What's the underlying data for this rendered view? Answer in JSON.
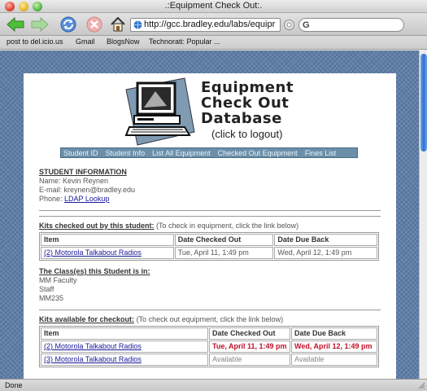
{
  "window": {
    "title": ".:Equipment Check Out:."
  },
  "toolbar": {
    "url": "http://gcc.bradley.edu/labs/equipr",
    "search_engine": "G"
  },
  "bookmarks": [
    "post to del.icio.us",
    "Gmail",
    "BlogsNow",
    "Technorati: Popular ..."
  ],
  "logo": {
    "line1": "Equipment",
    "line2": "Check Out",
    "line3": "Database",
    "sub": "(click to logout)"
  },
  "nav": [
    "Student ID",
    "Student Info",
    "List All Equipment",
    "Checked Out Equipment",
    "Fines List"
  ],
  "student": {
    "title": "STUDENT INFORMATION",
    "name_label": "Name:",
    "name": "Kevin Reynen",
    "email_label": "E-mail:",
    "email": "kreynen@bradley.edu",
    "phone_label": "Phone:",
    "phone_link": "LDAP Lookup"
  },
  "checked_out": {
    "title": "Kits checked out by this student:",
    "note": "(To check in equipment, click the link below)",
    "headers": [
      "Item",
      "Date Checked Out",
      "Date Due Back"
    ],
    "rows": [
      {
        "item": "(2) Motorola Talkabout Radios",
        "out": "Tue, April 11, 1:49 pm",
        "due": "Wed, April 12, 1:49 pm"
      }
    ]
  },
  "classes": {
    "title": "The Class(es) this Student is in:",
    "items": [
      "MM Faculty",
      "Staff",
      "MM235"
    ]
  },
  "available": {
    "title": "Kits available for checkout:",
    "note": "(To check out equipment, click the link below)",
    "headers": [
      "Item",
      "Date Checked Out",
      "Date Due Back"
    ],
    "rows": [
      {
        "item": "(2) Motorola Talkabout Radios",
        "out": "Tue, April 11, 1:49 pm",
        "due": "Wed, April 12, 1:49 pm"
      },
      {
        "item": "(3) Motorola Talkabout Radios",
        "out": "Available",
        "due": "Available"
      }
    ]
  },
  "status": {
    "text": "Done"
  },
  "colors": {
    "nav_bg": "#6b8fa8",
    "alert_red": "#c0102a",
    "link": "#1a1a9a"
  }
}
